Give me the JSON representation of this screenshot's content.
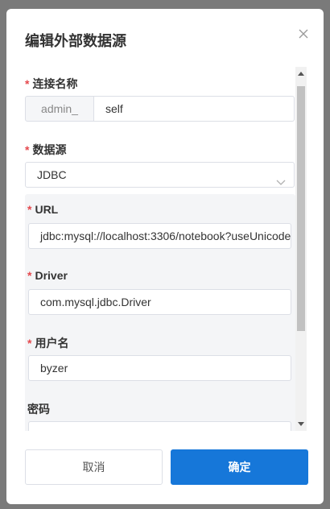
{
  "dialog": {
    "title": "编辑外部数据源",
    "icons": {
      "close": "close-icon",
      "select_arrow": "chevron-down-icon"
    }
  },
  "form": {
    "required_mark": "*",
    "connection_name": {
      "label": "连接名称",
      "prefix": "admin_",
      "value": "self"
    },
    "datasource": {
      "label": "数据源",
      "selected": "JDBC"
    },
    "url": {
      "label": "URL",
      "value": "jdbc:mysql://localhost:3306/notebook?useUnicode"
    },
    "driver": {
      "label": "Driver",
      "value": "com.mysql.jdbc.Driver"
    },
    "username": {
      "label": "用户名",
      "value": "byzer"
    },
    "password": {
      "label": "密码",
      "value": "••••••••••••••••••••••••••••••••"
    }
  },
  "footer": {
    "cancel_label": "取消",
    "ok_label": "确定"
  },
  "colors": {
    "primary": "#1677d9",
    "required": "#e5484d",
    "panel_bg": "#f4f5f7"
  }
}
